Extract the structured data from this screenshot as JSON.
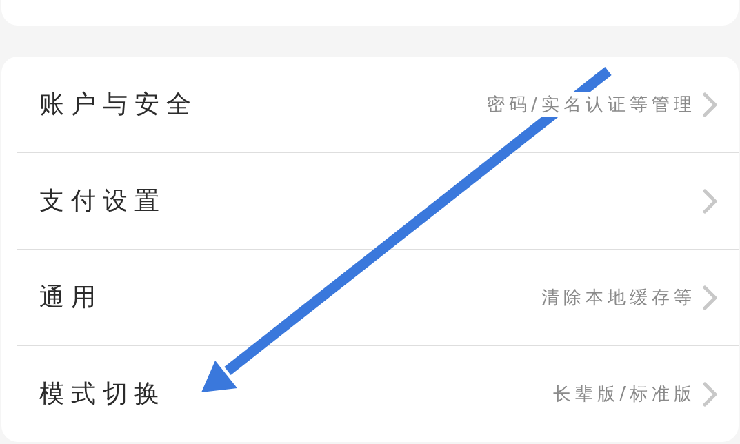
{
  "settings": [
    {
      "label": "账户与安全",
      "detail": "密码/实名认证等管理"
    },
    {
      "label": "支付设置"
    },
    {
      "label": "通用",
      "detail": "清除本地缓存等"
    },
    {
      "label": "模式切换",
      "detail": "长辈版/标准版"
    }
  ]
}
